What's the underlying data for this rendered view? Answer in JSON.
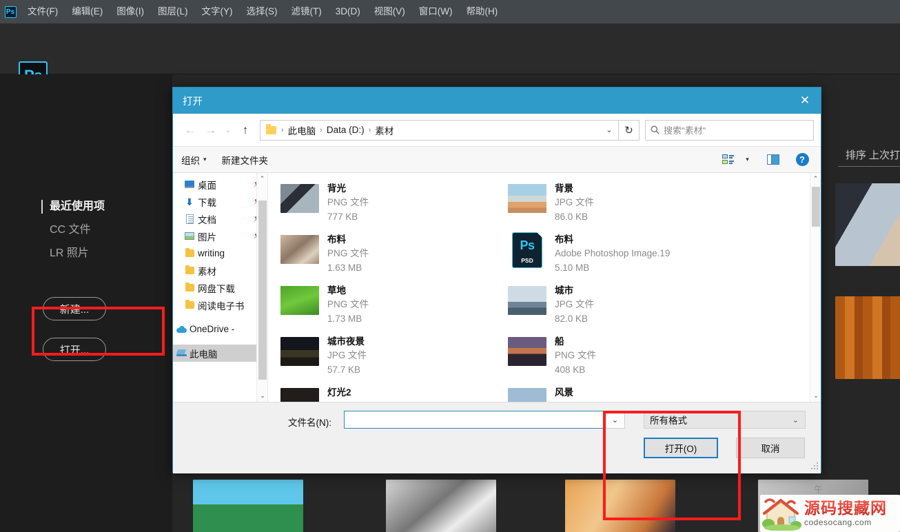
{
  "app": {
    "name": "Adobe Photoshop",
    "logo_text": "Ps",
    "menu": [
      {
        "label": "文件(F)"
      },
      {
        "label": "编辑(E)"
      },
      {
        "label": "图像(I)"
      },
      {
        "label": "图层(L)"
      },
      {
        "label": "文字(Y)"
      },
      {
        "label": "选择(S)"
      },
      {
        "label": "滤镜(T)"
      },
      {
        "label": "3D(D)"
      },
      {
        "label": "视图(V)"
      },
      {
        "label": "窗口(W)"
      },
      {
        "label": "帮助(H)"
      }
    ],
    "start_nav": [
      {
        "label": "最近使用项",
        "active": true
      },
      {
        "label": "CC 文件",
        "active": false
      },
      {
        "label": "LR 照片",
        "active": false
      }
    ],
    "buttons": {
      "new": "新建...",
      "open": "打开..."
    },
    "sort_label": "排序 上次打",
    "clipped_time": "午"
  },
  "dialog": {
    "title": "打开",
    "close_icon": "✕",
    "nav": {
      "back_icon": "←",
      "forward_icon": "→",
      "recent_icon": "⌄",
      "up_icon": "↑",
      "refresh_icon": "↻",
      "breadcrumb": [
        "此电脑",
        "Data (D:)",
        "素材"
      ],
      "breadcrumb_separator": "›",
      "breadcrumb_dropdown_icon": "⌄"
    },
    "search": {
      "icon": "search-icon",
      "placeholder": "搜索\"素材\""
    },
    "toolbar": {
      "organize": "组织",
      "organize_caret": "▾",
      "new_folder": "新建文件夹",
      "view_caret": "▾",
      "help_glyph": "?"
    },
    "tree": [
      {
        "label": "桌面",
        "icon": "desktop-icon",
        "pinned": true,
        "selected": false
      },
      {
        "label": "下载",
        "icon": "download-icon",
        "pinned": true,
        "selected": false
      },
      {
        "label": "文档",
        "icon": "document-icon",
        "pinned": true,
        "selected": false
      },
      {
        "label": "图片",
        "icon": "pictures-icon",
        "pinned": true,
        "selected": false
      },
      {
        "label": "writing",
        "icon": "folder-icon",
        "pinned": false,
        "selected": false
      },
      {
        "label": "素材",
        "icon": "folder-icon",
        "pinned": false,
        "selected": false
      },
      {
        "label": "网盘下载",
        "icon": "folder-icon",
        "pinned": false,
        "selected": false
      },
      {
        "label": "阅读电子书",
        "icon": "folder-icon",
        "pinned": false,
        "selected": false
      },
      {
        "label": "OneDrive -",
        "icon": "onedrive-icon",
        "pinned": false,
        "selected": false
      },
      {
        "label": "此电脑",
        "icon": "this-pc-icon",
        "pinned": false,
        "selected": true
      }
    ],
    "files": [
      {
        "name": "背光",
        "type": "PNG 文件",
        "size": "777 KB",
        "thumb": "portrait-backlight"
      },
      {
        "name": "背景",
        "type": "JPG 文件",
        "size": "86.0 KB",
        "thumb": "sky-sunset"
      },
      {
        "name": "布料",
        "type": "PNG 文件",
        "size": "1.63 MB",
        "thumb": "fabric"
      },
      {
        "name": "布料",
        "type": "Adobe Photoshop Image.19",
        "size": "5.10 MB",
        "thumb": "psd-icon"
      },
      {
        "name": "草地",
        "type": "PNG 文件",
        "size": "1.73 MB",
        "thumb": "grass"
      },
      {
        "name": "城市",
        "type": "JPG 文件",
        "size": "82.0 KB",
        "thumb": "city-day"
      },
      {
        "name": "城市夜景",
        "type": "JPG 文件",
        "size": "57.7 KB",
        "thumb": "city-night"
      },
      {
        "name": "船",
        "type": "PNG 文件",
        "size": "408 KB",
        "thumb": "boat"
      },
      {
        "name": "灯光2",
        "type": "",
        "size": "",
        "thumb": "lights"
      },
      {
        "name": "风景",
        "type": "",
        "size": "",
        "thumb": "landscape"
      }
    ],
    "bottom": {
      "filename_label": "文件名(N):",
      "filename_value": "",
      "filename_placeholder": "",
      "filename_dropdown_icon": "⌄",
      "filter_value": "所有格式",
      "filter_caret": "⌄",
      "open_button": "打开(O)",
      "cancel_button": "取消"
    }
  },
  "annotations": {
    "color": "#fc1c1c",
    "boxes": [
      {
        "name": "open-pill-highlight"
      },
      {
        "name": "open-button-highlight"
      }
    ]
  },
  "watermark": {
    "cn": "源码搜藏网",
    "en": "codesocang.com"
  }
}
